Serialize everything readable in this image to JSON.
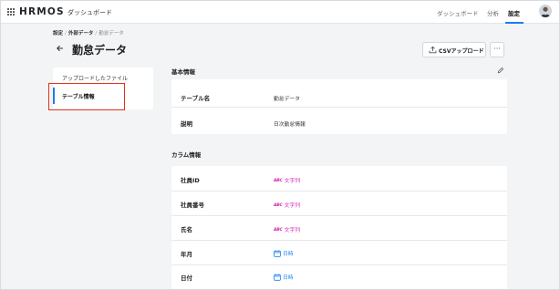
{
  "header": {
    "logo": "HRMOS",
    "app_name": "ダッシュボード",
    "nav": [
      "ダッシュボード",
      "分析",
      "設定"
    ],
    "active_nav": "設定"
  },
  "breadcrumb": {
    "items": [
      "設定",
      "外部データ"
    ],
    "current": "勤怠データ"
  },
  "page": {
    "title": "勤怠データ",
    "csv_button": "CSVアップロード",
    "more_button": "···"
  },
  "sidebar": {
    "items": [
      {
        "label": "アップロードしたファイル"
      },
      {
        "label": "テーブル情報"
      }
    ]
  },
  "basic_info": {
    "title": "基本情報",
    "rows": [
      {
        "label": "テーブル名",
        "value": "勤怠データ"
      },
      {
        "label": "説明",
        "value": "日次勤怠情報"
      }
    ]
  },
  "column_info": {
    "title": "カラム情報",
    "rows": [
      {
        "label": "社員ID",
        "type": "文字列",
        "icon": "abc-icon"
      },
      {
        "label": "社員番号",
        "type": "文字列",
        "icon": "abc-icon"
      },
      {
        "label": "氏名",
        "type": "文字列",
        "icon": "abc-icon"
      },
      {
        "label": "年月",
        "type": "日時",
        "icon": "calendar-icon"
      },
      {
        "label": "日付",
        "type": "日時",
        "icon": "calendar-icon"
      }
    ],
    "abc_glyph": "ABC"
  },
  "colors": {
    "accent": "#1a7df0",
    "string_type": "#d61fb0",
    "highlight": "#e0321b"
  }
}
